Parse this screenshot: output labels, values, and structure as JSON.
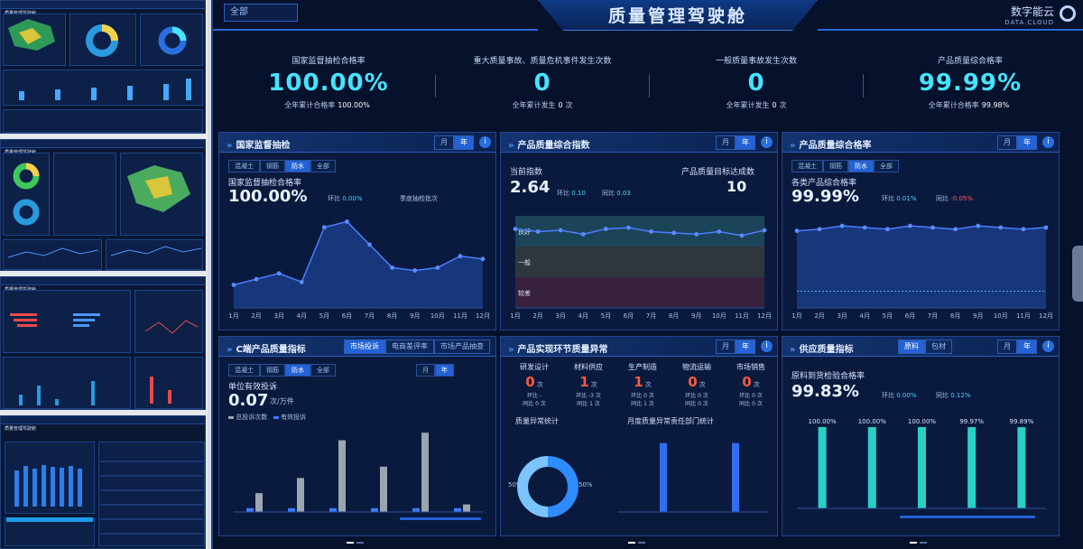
{
  "header": {
    "title": "质量管理驾驶舱",
    "brand_name": "数字能云",
    "brand_sub": "DATA.CLOUD",
    "selector_value": "全部"
  },
  "kpis": [
    {
      "label": "国家监督抽检合格率",
      "value": "100.00%",
      "sub_label": "全年累计合格率",
      "sub_value": "100.00%",
      "sub_unit": ""
    },
    {
      "label": "重大质量事故、质量危机事件发生次数",
      "value": "0",
      "sub_label": "全年累计发生",
      "sub_value": "0",
      "sub_unit": "次"
    },
    {
      "label": "一般质量事故发生次数",
      "value": "0",
      "sub_label": "全年累计发生",
      "sub_value": "0",
      "sub_unit": "次"
    },
    {
      "label": "产品质量综合格率",
      "value": "99.99%",
      "sub_label": "全年累计合格率",
      "sub_value": "99.98%",
      "sub_unit": ""
    }
  ],
  "panels": {
    "national": {
      "title": "国家监督抽检",
      "seg": [
        "月",
        "年"
      ],
      "tabs": [
        "混凝土",
        "钢筋",
        "防水",
        "全部"
      ],
      "metric_label": "国家监督抽检合格率",
      "metric_value": "100.00%",
      "ring_label": "环比",
      "ring_value": "0.00%",
      "extra_label": "季度抽检批次",
      "chart_data": {
        "type": "area",
        "categories": [
          "1月",
          "2月",
          "3月",
          "4月",
          "5月",
          "6月",
          "7月",
          "8月",
          "9月",
          "10月",
          "11月",
          "12月"
        ],
        "values": [
          8,
          10,
          12,
          9,
          28,
          30,
          22,
          14,
          13,
          14,
          18,
          17
        ],
        "ylim": [
          0,
          32
        ]
      }
    },
    "index": {
      "title": "产品质量综合指数",
      "seg": [
        "月",
        "年"
      ],
      "metric_label": "当前指数",
      "metric_value": "2.64",
      "ring_label": "环比",
      "ring_value": "0.10",
      "yoy_label": "同比",
      "yoy_value": "0.03",
      "target_label": "产品质量目标达成数",
      "target_value": "10",
      "band_labels": [
        "良好",
        "一般",
        "较差"
      ],
      "chart_data": {
        "type": "line",
        "categories": [
          "1月",
          "2月",
          "3月",
          "4月",
          "5月",
          "6月",
          "7月",
          "8月",
          "9月",
          "10月",
          "11月",
          "12月"
        ],
        "values": [
          2.7,
          2.66,
          2.68,
          2.62,
          2.7,
          2.72,
          2.66,
          2.64,
          2.62,
          2.66,
          2.6,
          2.68
        ],
        "ylim": [
          1.5,
          2.9
        ]
      }
    },
    "composite": {
      "title": "产品质量综合格率",
      "seg": [
        "月",
        "年"
      ],
      "tabs": [
        "混凝土",
        "钢筋",
        "防水",
        "全部"
      ],
      "metric_label": "各类产品综合格率",
      "metric_value": "99.99%",
      "ring_label": "环比",
      "ring_value": "0.01%",
      "yoy_label": "同比",
      "yoy_value": "-0.05%",
      "chart_data": {
        "type": "area",
        "categories": [
          "1月",
          "2月",
          "3月",
          "4月",
          "5月",
          "6月",
          "7月",
          "8月",
          "9月",
          "10月",
          "11月",
          "12月"
        ],
        "values": [
          99.96,
          99.97,
          99.99,
          99.98,
          99.97,
          99.99,
          99.98,
          99.97,
          99.99,
          99.98,
          99.97,
          99.98
        ],
        "ylim": [
          99.5,
          100.05
        ]
      }
    },
    "terminal": {
      "title": "C端产品质量指标",
      "tabs_top": [
        "市场投诉",
        "电商差评率",
        "市场产品抽查"
      ],
      "seg": [
        "月",
        "年"
      ],
      "tabs": [
        "混凝土",
        "钢筋",
        "防水",
        "全部"
      ],
      "metric_label": "单位有效投诉",
      "metric_value": "0.07",
      "metric_unit": "次/万件",
      "legend": [
        "有效投诉",
        "总投诉次数"
      ],
      "chart_data": {
        "type": "bar",
        "categories": [
          "1",
          "2",
          "3",
          "4",
          "5",
          "6"
        ],
        "series": [
          {
            "name": "有效投诉",
            "values": [
              1,
              1,
              1,
              1,
              1,
              1
            ]
          },
          {
            "name": "总投诉次数",
            "values": [
              5,
              9,
              19,
              12,
              21,
              2
            ]
          }
        ],
        "ylim": [
          0,
          22
        ]
      }
    },
    "process": {
      "title": "产品实现环节质量异常",
      "seg": [
        "月",
        "年"
      ],
      "stats": [
        {
          "label": "研发设计",
          "value": "0",
          "unit": "次",
          "ring": "环比 -",
          "yoy": "同比 0 次"
        },
        {
          "label": "材料供应",
          "value": "1",
          "unit": "次",
          "ring": "环比 -3 次",
          "yoy": "同比 1 次"
        },
        {
          "label": "生产制造",
          "value": "1",
          "unit": "次",
          "ring": "环比 0 次",
          "yoy": "同比 1 次"
        },
        {
          "label": "物流运输",
          "value": "0",
          "unit": "次",
          "ring": "环比 0 次",
          "yoy": "同比 0 次"
        },
        {
          "label": "市场销售",
          "value": "0",
          "unit": "次",
          "ring": "环比 0 次",
          "yoy": "同比 0 次"
        }
      ],
      "donut_title": "质量异常统计",
      "donut_left": "50%",
      "donut_right": "50%",
      "bar_title": "月度质量异常责任部门统计",
      "chart_data": [
        {
          "type": "pie",
          "values": [
            50,
            50
          ]
        },
        {
          "type": "bar",
          "categories": [
            "A",
            "B"
          ],
          "values": [
            1,
            1
          ],
          "ylim": [
            0,
            1.1
          ]
        }
      ]
    },
    "supply": {
      "title": "供应质量指标",
      "tabs_top": [
        "原料",
        "包材"
      ],
      "seg": [
        "月",
        "年"
      ],
      "metric_label": "原料到货检验合格率",
      "metric_value": "99.83%",
      "ring_label": "环比",
      "ring_value": "0.00%",
      "yoy_label": "同比",
      "yoy_value": "0.12%",
      "chart_data": {
        "type": "bar",
        "categories": [
          "1",
          "2",
          "3",
          "4",
          "5"
        ],
        "values": [
          100.0,
          100.0,
          100.0,
          99.97,
          99.89
        ],
        "labels": [
          "100.00%",
          "100.00%",
          "100.00%",
          "99.97%",
          "99.89%"
        ],
        "ylim": [
          0,
          100
        ]
      }
    }
  },
  "thumbs": [
    {
      "title": "质量管理驾驶舱"
    },
    {
      "title": "质量管理驾驶舱"
    },
    {
      "title": "质量管理驾驶舱"
    },
    {
      "title": "质量管理驾驶舱"
    }
  ]
}
